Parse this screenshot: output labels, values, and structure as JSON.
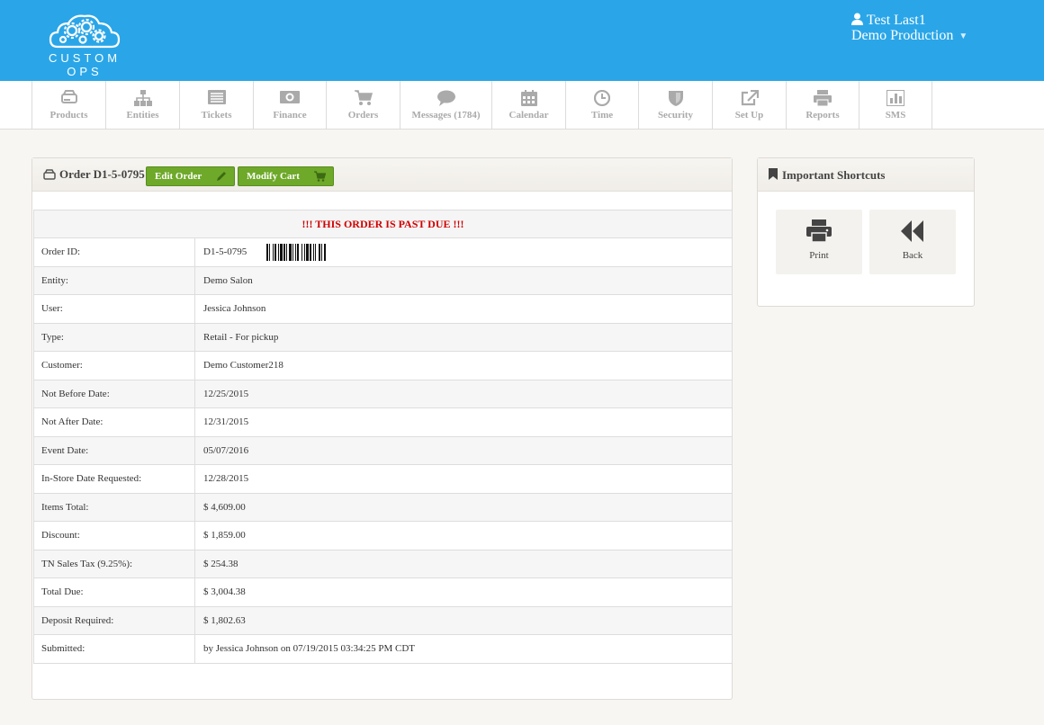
{
  "header": {
    "logo_text": "CUSTOM OPS",
    "user_name": "Test Last1",
    "org_name": "Demo Production",
    "bar_color": "#2aa6e8"
  },
  "nav": [
    {
      "label": "Products",
      "icon": "drive-icon"
    },
    {
      "label": "Entities",
      "icon": "sitemap-icon"
    },
    {
      "label": "Tickets",
      "icon": "list-icon"
    },
    {
      "label": "Finance",
      "icon": "money-icon"
    },
    {
      "label": "Orders",
      "icon": "cart-icon"
    },
    {
      "label": "Messages (1784)",
      "icon": "chat-icon"
    },
    {
      "label": "Calendar",
      "icon": "calendar-icon"
    },
    {
      "label": "Time",
      "icon": "clock-icon"
    },
    {
      "label": "Security",
      "icon": "shield-icon"
    },
    {
      "label": "Set Up",
      "icon": "external-link-icon"
    },
    {
      "label": "Reports",
      "icon": "print-icon"
    },
    {
      "label": "SMS",
      "icon": "bar-chart-icon"
    }
  ],
  "order": {
    "title": "Order D1-5-0795",
    "edit_label": "Edit Order",
    "modify_label": "Modify Cart",
    "button_color": "#6ea92a",
    "past_due": "!!! THIS ORDER IS PAST DUE !!!",
    "rows": [
      {
        "key": "Order ID:",
        "value": "D1-5-0795"
      },
      {
        "key": "Entity:",
        "value": "Demo Salon"
      },
      {
        "key": "User:",
        "value": "Jessica Johnson"
      },
      {
        "key": "Type:",
        "value": "Retail - For pickup"
      },
      {
        "key": "Customer:",
        "value": "Demo Customer218"
      },
      {
        "key": "Not Before Date:",
        "value": "12/25/2015"
      },
      {
        "key": "Not After Date:",
        "value": "12/31/2015"
      },
      {
        "key": "Event Date:",
        "value": "05/07/2016"
      },
      {
        "key": "In-Store Date Requested:",
        "value": "12/28/2015"
      },
      {
        "key": "Items Total:",
        "value": "$ 4,609.00"
      },
      {
        "key": "Discount:",
        "value": "$ 1,859.00"
      },
      {
        "key": "TN Sales Tax (9.25%):",
        "value": "$ 254.38"
      },
      {
        "key": "Total Due:",
        "value": "$ 3,004.38"
      },
      {
        "key": "Deposit Required:",
        "value": "$ 1,802.63"
      },
      {
        "key": "Submitted:",
        "value": "by Jessica Johnson on 07/19/2015 03:34:25 PM CDT"
      }
    ]
  },
  "shortcuts": {
    "title": "Important Shortcuts",
    "print_label": "Print",
    "back_label": "Back"
  }
}
